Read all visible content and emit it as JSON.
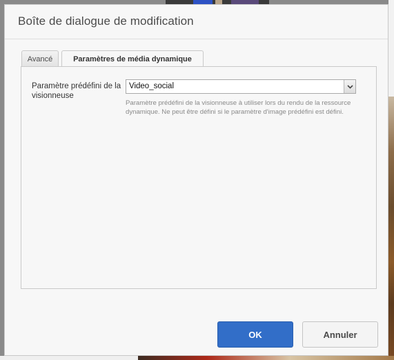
{
  "dialog": {
    "title": "Boîte de dialogue de modification"
  },
  "tabs": [
    {
      "label": "Avancé",
      "active": false
    },
    {
      "label": "Paramètres de média dynamique",
      "active": true
    }
  ],
  "field": {
    "label": "Paramètre prédéfini de la visionneuse",
    "selected_value": "Video_social",
    "help": "Paramètre prédéfini de la visionneuse à utiliser lors du rendu de la ressource dynamique. Ne peut être défini si le paramètre d'image prédéfini est défini."
  },
  "buttons": {
    "ok": "OK",
    "cancel": "Annuler"
  },
  "colors": {
    "primary_button": "#326ec8",
    "dialog_background": "#f7f7f7"
  }
}
